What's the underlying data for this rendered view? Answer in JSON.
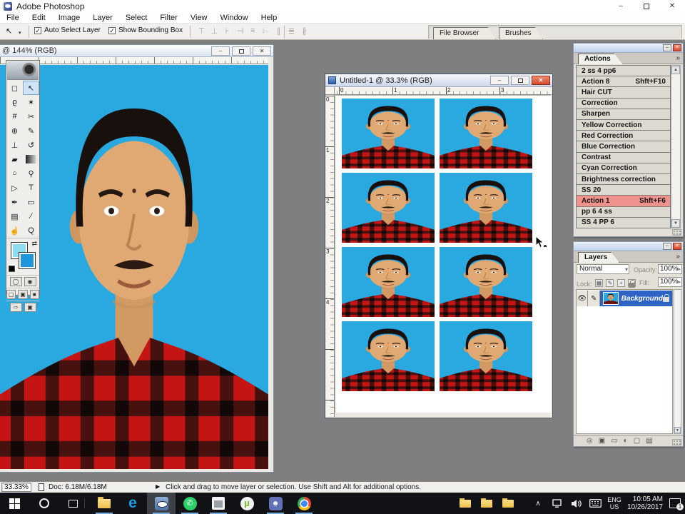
{
  "window": {
    "title": "Adobe Photoshop"
  },
  "menu": {
    "items": [
      "File",
      "Edit",
      "Image",
      "Layer",
      "Select",
      "Filter",
      "View",
      "Window",
      "Help"
    ]
  },
  "options_bar": {
    "auto_select_label": "Auto Select Layer",
    "show_bounding_label": "Show Bounding Box",
    "tabs": [
      "File Browser",
      "Brushes"
    ],
    "align_icons": [
      "align-top",
      "align-vertical-center",
      "align-bottom",
      "align-left",
      "align-horizontal-center",
      "align-right",
      "distribute-top",
      "distribute-vertical-center",
      "distribute-bottom"
    ]
  },
  "left_document": {
    "title": "@ 144% (RGB)"
  },
  "center_document": {
    "title": "Untitled-1 @ 33.3% (RGB)",
    "h_ticks": [
      "0",
      "1",
      "2",
      "3"
    ],
    "v_ticks": [
      "0",
      "1",
      "2",
      "3",
      "4"
    ],
    "grid": {
      "rows": 4,
      "cols": 2
    }
  },
  "toolbox": {
    "tools": [
      {
        "name": "rectangular-marquee",
        "glyph": "◻",
        "selected": false
      },
      {
        "name": "move",
        "glyph": "↖",
        "selected": true
      },
      {
        "name": "lasso",
        "glyph": "ϱ",
        "selected": false
      },
      {
        "name": "magic-wand",
        "glyph": "✶",
        "selected": false
      },
      {
        "name": "crop",
        "glyph": "#",
        "selected": false
      },
      {
        "name": "slice",
        "glyph": "✂",
        "selected": false
      },
      {
        "name": "healing-brush",
        "glyph": "⊕",
        "selected": false
      },
      {
        "name": "brush",
        "glyph": "✎",
        "selected": false
      },
      {
        "name": "clone-stamp",
        "glyph": "⊥",
        "selected": false
      },
      {
        "name": "history-brush",
        "glyph": "↺",
        "selected": false
      },
      {
        "name": "eraser",
        "glyph": "▰",
        "selected": false
      },
      {
        "name": "gradient",
        "glyph": "",
        "selected": false
      },
      {
        "name": "blur",
        "glyph": "○",
        "selected": false
      },
      {
        "name": "dodge",
        "glyph": "⚲",
        "selected": false
      },
      {
        "name": "path-selection",
        "glyph": "▷",
        "selected": false
      },
      {
        "name": "type",
        "glyph": "T",
        "selected": false
      },
      {
        "name": "pen",
        "glyph": "✒",
        "selected": false
      },
      {
        "name": "custom-shape",
        "glyph": "▭",
        "selected": false
      },
      {
        "name": "notes",
        "glyph": "▤",
        "selected": false
      },
      {
        "name": "eyedropper",
        "glyph": "∕",
        "selected": false
      },
      {
        "name": "hand",
        "glyph": "☝",
        "selected": false
      },
      {
        "name": "zoom",
        "glyph": "Q",
        "selected": false
      }
    ]
  },
  "actions_panel": {
    "tab": "Actions",
    "items": [
      {
        "label": "2 ss 4 pp6",
        "shortcut": "",
        "highlighted": false
      },
      {
        "label": "Action 8",
        "shortcut": "Shft+F10",
        "highlighted": false
      },
      {
        "label": "Hair CUT",
        "shortcut": "",
        "highlighted": false
      },
      {
        "label": "Correction",
        "shortcut": "",
        "highlighted": false
      },
      {
        "label": "Sharpen",
        "shortcut": "",
        "highlighted": false
      },
      {
        "label": "Yellow Correction",
        "shortcut": "",
        "highlighted": false
      },
      {
        "label": "Red Correction",
        "shortcut": "",
        "highlighted": false
      },
      {
        "label": "Blue Correction",
        "shortcut": "",
        "highlighted": false
      },
      {
        "label": "Contrast",
        "shortcut": "",
        "highlighted": false
      },
      {
        "label": "Cyan Correction",
        "shortcut": "",
        "highlighted": false
      },
      {
        "label": "Brightness correction",
        "shortcut": "",
        "highlighted": false
      },
      {
        "label": "SS 20",
        "shortcut": "",
        "highlighted": false
      },
      {
        "label": "Action 1",
        "shortcut": "Shft+F6",
        "highlighted": true
      },
      {
        "label": "pp 6 4 ss",
        "shortcut": "",
        "highlighted": false
      },
      {
        "label": "SS 4 PP 6",
        "shortcut": "",
        "highlighted": false
      }
    ]
  },
  "layers_panel": {
    "tab": "Layers",
    "blend_mode": "Normal",
    "opacity_label": "Opacity:",
    "opacity_value": "100%",
    "lock_label": "Lock:",
    "lock_icons": [
      "▦",
      "✎",
      "+"
    ],
    "fill_label": "Fill:",
    "fill_value": "100%",
    "layer_name": "Background",
    "footer_icons": [
      "◎",
      "▣",
      "▭",
      "◐",
      "▢",
      "▤"
    ]
  },
  "status_bar": {
    "zoom": "33.33%",
    "doc": "Doc: 6.18M/6.18M",
    "hint": "Click and drag to move layer or selection. Use Shift and Alt for additional options."
  },
  "taskbar": {
    "apps": [
      "file-explorer",
      "edge",
      "photoshop",
      "whatsapp",
      "movie-app",
      "utorrent",
      "discord",
      "chrome"
    ],
    "lang_line1": "ENG",
    "lang_line2": "US",
    "clock_time": "10:05 AM",
    "clock_date": "10/26/2017",
    "notification_count": "1"
  },
  "icons": {
    "check": "✓",
    "chevrons": "»",
    "up": "▲",
    "down": "▼",
    "dropdown": "▾",
    "side": "▸",
    "play": "▶",
    "swap": "⇄",
    "tray_chevron": "∧",
    "whatsapp_glyph": "✆",
    "utorrent_glyph": "µ",
    "discord_glyph": "☻",
    "minimize": "–",
    "close": "✕"
  },
  "colors": {
    "foreground_swatch": "#8edcf2",
    "background_swatch": "#1f97dd",
    "photo_background": "#2aa9e1",
    "action_highlight": "#ef928d",
    "selected_layer": "#2c63c5"
  }
}
